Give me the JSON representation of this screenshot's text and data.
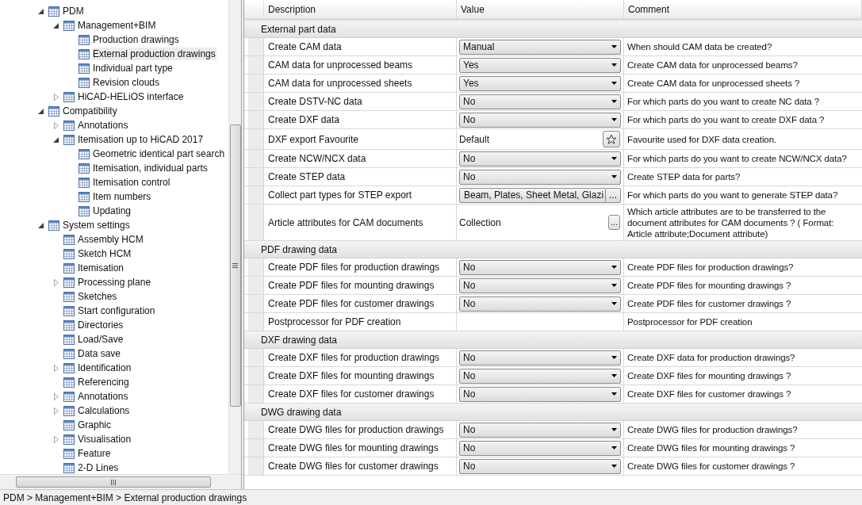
{
  "tree": [
    {
      "label": "PDM",
      "expanded": true,
      "selected": false,
      "children": [
        {
          "label": "Management+BIM",
          "expanded": true,
          "selected": false,
          "children": [
            {
              "label": "Production drawings",
              "selected": false
            },
            {
              "label": "External production drawings",
              "selected": true
            },
            {
              "label": "Individual part type",
              "selected": false
            },
            {
              "label": "Revision clouds",
              "selected": false
            }
          ]
        },
        {
          "label": "HiCAD-HELiOS interface",
          "expanded": false,
          "selected": false
        }
      ]
    },
    {
      "label": "Compatibility",
      "expanded": true,
      "selected": false,
      "children": [
        {
          "label": "Annotations",
          "expanded": false,
          "selected": false
        },
        {
          "label": "Itemisation up to HiCAD 2017",
          "expanded": true,
          "selected": false,
          "children": [
            {
              "label": "Geometric identical part search",
              "selected": false
            },
            {
              "label": "Itemisation, individual parts",
              "selected": false
            },
            {
              "label": "Itemisation control",
              "selected": false
            },
            {
              "label": "Item numbers",
              "selected": false
            },
            {
              "label": "Updating",
              "selected": false
            }
          ]
        }
      ]
    },
    {
      "label": "System settings",
      "expanded": true,
      "selected": false,
      "children": [
        {
          "label": "Assembly HCM",
          "selected": false
        },
        {
          "label": "Sketch HCM",
          "selected": false
        },
        {
          "label": "Itemisation",
          "selected": false
        },
        {
          "label": "Processing plane",
          "expanded": false,
          "selected": false
        },
        {
          "label": "Sketches",
          "selected": false
        },
        {
          "label": "Start configuration",
          "selected": false
        },
        {
          "label": "Directories",
          "selected": false
        },
        {
          "label": "Load/Save",
          "selected": false
        },
        {
          "label": "Data save",
          "selected": false
        },
        {
          "label": "Identification",
          "expanded": false,
          "selected": false
        },
        {
          "label": "Referencing",
          "selected": false
        },
        {
          "label": "Annotations",
          "expanded": false,
          "selected": false
        },
        {
          "label": "Calculations",
          "expanded": false,
          "selected": false
        },
        {
          "label": "Graphic",
          "selected": false
        },
        {
          "label": "Visualisation",
          "expanded": false,
          "selected": false
        },
        {
          "label": "Feature",
          "selected": false
        },
        {
          "label": "2-D Lines",
          "selected": false
        }
      ]
    }
  ],
  "table": {
    "columns": [
      "Description",
      "Value",
      "Comment"
    ],
    "groups": [
      {
        "title": "External part data",
        "rows": [
          {
            "description": "Create CAM data",
            "kind": "dropdown",
            "value": "Manual",
            "comment": "When should CAM data be created?"
          },
          {
            "description": "CAM data for unprocessed beams",
            "kind": "dropdown",
            "value": "Yes",
            "comment": "Create CAM data for unprocessed beams?"
          },
          {
            "description": "CAM data for unprocessed sheets",
            "kind": "dropdown",
            "value": "Yes",
            "comment": "Create CAM data for unprocessed sheets ?"
          },
          {
            "description": "Create DSTV-NC data",
            "kind": "dropdown",
            "value": "No",
            "comment": "For which parts do you want to create NC data ?"
          },
          {
            "description": "Create DXF data",
            "kind": "dropdown",
            "value": "No",
            "comment": "For which parts do you want to create DXF data ?"
          },
          {
            "description": "DXF export Favourite",
            "kind": "favourite",
            "value": "Default",
            "comment": "Favourite used for DXF data creation."
          },
          {
            "description": "Create NCW/NCX data",
            "kind": "dropdown",
            "value": "No",
            "comment": "For which parts do you want to create NCW/NCX data?"
          },
          {
            "description": "Create STEP data",
            "kind": "dropdown",
            "value": "No",
            "comment": "Create STEP data for parts?"
          },
          {
            "description": "Collect part types for STEP export",
            "kind": "picker",
            "value": "Beam, Plates, Sheet Metal, Glazi",
            "button": "...",
            "comment": "For which parts do you want to generate STEP data?"
          },
          {
            "description": "Article attributes for CAM documents",
            "kind": "collection",
            "value": "Collection",
            "button": "...",
            "comment": "Which article attributes are to be transferred to the document attributes for CAM documents ? ( Format: Article attribute;Document attribute)"
          }
        ]
      },
      {
        "title": "PDF drawing data",
        "rows": [
          {
            "description": "Create PDF files for production drawings",
            "kind": "dropdown",
            "value": "No",
            "comment": "Create PDF files for production drawings?"
          },
          {
            "description": "Create PDF files for mounting drawings",
            "kind": "dropdown",
            "value": "No",
            "comment": "Create PDF files for mounting drawings ?"
          },
          {
            "description": "Create PDF files for customer drawings",
            "kind": "dropdown",
            "value": "No",
            "comment": "Create PDF files for customer drawings ?"
          },
          {
            "description": "Postprocessor for PDF creation",
            "kind": "text",
            "comment": "Postprocessor for PDF creation"
          }
        ]
      },
      {
        "title": "DXF drawing data",
        "rows": [
          {
            "description": "Create DXF files for production drawings",
            "kind": "dropdown",
            "value": "No",
            "comment": "Create DXF data for production drawings?"
          },
          {
            "description": "Create DXF files for mounting drawings",
            "kind": "dropdown",
            "value": "No",
            "comment": "Create DXF files for mounting drawings ?"
          },
          {
            "description": "Create DXF files for customer drawings",
            "kind": "dropdown",
            "value": "No",
            "comment": "Create DXF files for customer drawings ?"
          }
        ]
      },
      {
        "title": "DWG drawing data",
        "rows": [
          {
            "description": "Create DWG files for production drawings",
            "kind": "dropdown",
            "value": "No",
            "comment": "Create DWG files for production drawings?"
          },
          {
            "description": "Create DWG files for mounting drawings",
            "kind": "dropdown",
            "value": "No",
            "comment": "Create DWG files for mounting drawings ?"
          },
          {
            "description": "Create DWG files for customer drawings",
            "kind": "dropdown",
            "value": "No",
            "comment": "Create DWG files for customer drawings ?"
          }
        ]
      }
    ]
  },
  "status_bar": "PDM > Management+BIM > External production drawings"
}
